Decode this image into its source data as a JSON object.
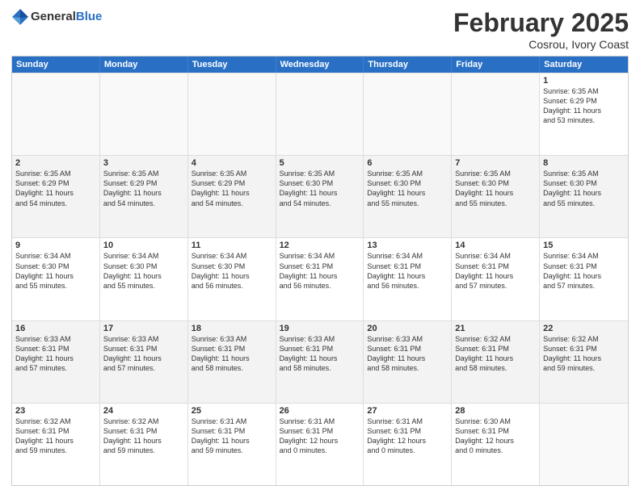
{
  "header": {
    "logo_general": "General",
    "logo_blue": "Blue",
    "month_title": "February 2025",
    "location": "Cosrou, Ivory Coast"
  },
  "weekdays": [
    "Sunday",
    "Monday",
    "Tuesday",
    "Wednesday",
    "Thursday",
    "Friday",
    "Saturday"
  ],
  "weeks": [
    [
      {
        "day": "",
        "text": "",
        "empty": true
      },
      {
        "day": "",
        "text": "",
        "empty": true
      },
      {
        "day": "",
        "text": "",
        "empty": true
      },
      {
        "day": "",
        "text": "",
        "empty": true
      },
      {
        "day": "",
        "text": "",
        "empty": true
      },
      {
        "day": "",
        "text": "",
        "empty": true
      },
      {
        "day": "1",
        "text": "Sunrise: 6:35 AM\nSunset: 6:29 PM\nDaylight: 11 hours\nand 53 minutes.",
        "empty": false
      }
    ],
    [
      {
        "day": "2",
        "text": "Sunrise: 6:35 AM\nSunset: 6:29 PM\nDaylight: 11 hours\nand 54 minutes.",
        "empty": false
      },
      {
        "day": "3",
        "text": "Sunrise: 6:35 AM\nSunset: 6:29 PM\nDaylight: 11 hours\nand 54 minutes.",
        "empty": false
      },
      {
        "day": "4",
        "text": "Sunrise: 6:35 AM\nSunset: 6:29 PM\nDaylight: 11 hours\nand 54 minutes.",
        "empty": false
      },
      {
        "day": "5",
        "text": "Sunrise: 6:35 AM\nSunset: 6:30 PM\nDaylight: 11 hours\nand 54 minutes.",
        "empty": false
      },
      {
        "day": "6",
        "text": "Sunrise: 6:35 AM\nSunset: 6:30 PM\nDaylight: 11 hours\nand 55 minutes.",
        "empty": false
      },
      {
        "day": "7",
        "text": "Sunrise: 6:35 AM\nSunset: 6:30 PM\nDaylight: 11 hours\nand 55 minutes.",
        "empty": false
      },
      {
        "day": "8",
        "text": "Sunrise: 6:35 AM\nSunset: 6:30 PM\nDaylight: 11 hours\nand 55 minutes.",
        "empty": false
      }
    ],
    [
      {
        "day": "9",
        "text": "Sunrise: 6:34 AM\nSunset: 6:30 PM\nDaylight: 11 hours\nand 55 minutes.",
        "empty": false
      },
      {
        "day": "10",
        "text": "Sunrise: 6:34 AM\nSunset: 6:30 PM\nDaylight: 11 hours\nand 55 minutes.",
        "empty": false
      },
      {
        "day": "11",
        "text": "Sunrise: 6:34 AM\nSunset: 6:30 PM\nDaylight: 11 hours\nand 56 minutes.",
        "empty": false
      },
      {
        "day": "12",
        "text": "Sunrise: 6:34 AM\nSunset: 6:31 PM\nDaylight: 11 hours\nand 56 minutes.",
        "empty": false
      },
      {
        "day": "13",
        "text": "Sunrise: 6:34 AM\nSunset: 6:31 PM\nDaylight: 11 hours\nand 56 minutes.",
        "empty": false
      },
      {
        "day": "14",
        "text": "Sunrise: 6:34 AM\nSunset: 6:31 PM\nDaylight: 11 hours\nand 57 minutes.",
        "empty": false
      },
      {
        "day": "15",
        "text": "Sunrise: 6:34 AM\nSunset: 6:31 PM\nDaylight: 11 hours\nand 57 minutes.",
        "empty": false
      }
    ],
    [
      {
        "day": "16",
        "text": "Sunrise: 6:33 AM\nSunset: 6:31 PM\nDaylight: 11 hours\nand 57 minutes.",
        "empty": false
      },
      {
        "day": "17",
        "text": "Sunrise: 6:33 AM\nSunset: 6:31 PM\nDaylight: 11 hours\nand 57 minutes.",
        "empty": false
      },
      {
        "day": "18",
        "text": "Sunrise: 6:33 AM\nSunset: 6:31 PM\nDaylight: 11 hours\nand 58 minutes.",
        "empty": false
      },
      {
        "day": "19",
        "text": "Sunrise: 6:33 AM\nSunset: 6:31 PM\nDaylight: 11 hours\nand 58 minutes.",
        "empty": false
      },
      {
        "day": "20",
        "text": "Sunrise: 6:33 AM\nSunset: 6:31 PM\nDaylight: 11 hours\nand 58 minutes.",
        "empty": false
      },
      {
        "day": "21",
        "text": "Sunrise: 6:32 AM\nSunset: 6:31 PM\nDaylight: 11 hours\nand 58 minutes.",
        "empty": false
      },
      {
        "day": "22",
        "text": "Sunrise: 6:32 AM\nSunset: 6:31 PM\nDaylight: 11 hours\nand 59 minutes.",
        "empty": false
      }
    ],
    [
      {
        "day": "23",
        "text": "Sunrise: 6:32 AM\nSunset: 6:31 PM\nDaylight: 11 hours\nand 59 minutes.",
        "empty": false
      },
      {
        "day": "24",
        "text": "Sunrise: 6:32 AM\nSunset: 6:31 PM\nDaylight: 11 hours\nand 59 minutes.",
        "empty": false
      },
      {
        "day": "25",
        "text": "Sunrise: 6:31 AM\nSunset: 6:31 PM\nDaylight: 11 hours\nand 59 minutes.",
        "empty": false
      },
      {
        "day": "26",
        "text": "Sunrise: 6:31 AM\nSunset: 6:31 PM\nDaylight: 12 hours\nand 0 minutes.",
        "empty": false
      },
      {
        "day": "27",
        "text": "Sunrise: 6:31 AM\nSunset: 6:31 PM\nDaylight: 12 hours\nand 0 minutes.",
        "empty": false
      },
      {
        "day": "28",
        "text": "Sunrise: 6:30 AM\nSunset: 6:31 PM\nDaylight: 12 hours\nand 0 minutes.",
        "empty": false
      },
      {
        "day": "",
        "text": "",
        "empty": true
      }
    ]
  ]
}
